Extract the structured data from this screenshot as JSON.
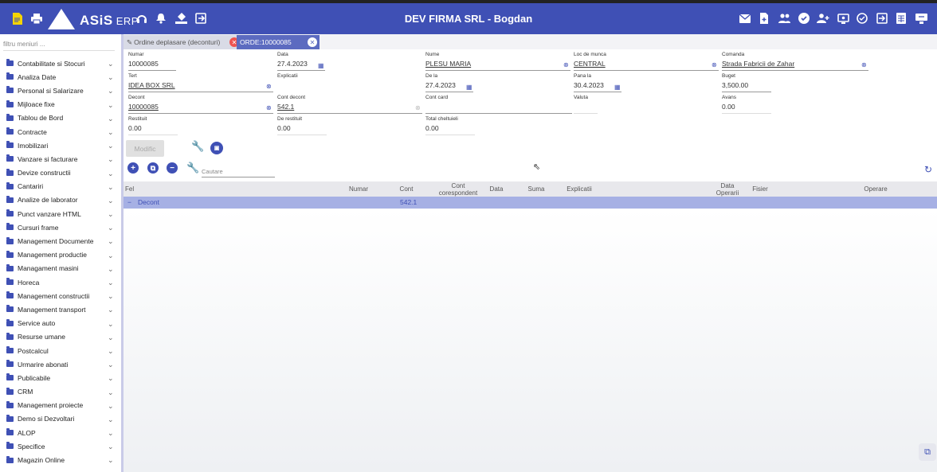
{
  "topbar": {
    "logo_text": "ASiS",
    "logo_suffix": "ERP",
    "title": "DEV FIRMA SRL - Bogdan",
    "left_icons": [
      "document-icon",
      "printer-icon",
      "headset-icon",
      "bell-icon",
      "paint-bucket-icon",
      "exit-icon"
    ],
    "right_icons": [
      "mail-icon",
      "new-file-icon",
      "users-icon",
      "check-circle-icon",
      "user-add-icon",
      "screen-icon",
      "refresh-circle-icon",
      "logout-icon",
      "calculator-icon",
      "desktop-icon"
    ]
  },
  "sidebar": {
    "filter_placeholder": "filtru meniuri ...",
    "items": [
      "Contabilitate si Stocuri",
      "Analiza Date",
      "Personal si Salarizare",
      "Mijloace fixe",
      "Tablou de Bord",
      "Contracte",
      "Imobilizari",
      "Vanzare si facturare",
      "Devize constructii",
      "Cantariri",
      "Analize de laborator",
      "Punct vanzare HTML",
      "Cursuri frame",
      "Management Documente",
      "Management productie",
      "Managament masini",
      "Horeca",
      "Management constructii",
      "Management transport",
      "Service auto",
      "Resurse umane",
      "Postcalcul",
      "Urmarire abonati",
      "Publicabile",
      "CRM",
      "Management proiecte",
      "Demo si Dezvoltari",
      "ALOP",
      "Specifice",
      "Magazin Online"
    ]
  },
  "tabs": [
    {
      "label": "Ordine deplasare (deconturi)"
    },
    {
      "label": "ORDE:10000085"
    }
  ],
  "form": {
    "numar": {
      "label": "Numar",
      "value": "10000085"
    },
    "data": {
      "label": "Data",
      "value": "27.4.2023"
    },
    "nume": {
      "label": "Nume",
      "value": "PLESU MARIA"
    },
    "loc_munca": {
      "label": "Loc de munca",
      "value": "CENTRAL"
    },
    "comanda": {
      "label": "Comanda",
      "value": "Strada Fabricii de Zahar"
    },
    "tert": {
      "label": "Tert",
      "value": "IDEA BOX SRL"
    },
    "explicatii": {
      "label": "Explicatii",
      "value": ""
    },
    "de_la": {
      "label": "De la",
      "value": "27.4.2023"
    },
    "pana_la": {
      "label": "Pana la",
      "value": "30.4.2023"
    },
    "buget": {
      "label": "Buget",
      "value": "3,500.00"
    },
    "decont": {
      "label": "Decont",
      "value": "10000085"
    },
    "cont_decont": {
      "label": "Cont decont",
      "value": "542.1"
    },
    "cont_card": {
      "label": "Cont card",
      "value": ""
    },
    "valuta": {
      "label": "Valuta",
      "value": ""
    },
    "avans": {
      "label": "Avans",
      "value": "0.00"
    },
    "restituit": {
      "label": "Restituit",
      "value": "0.00"
    },
    "de_restituit": {
      "label": "De restituit",
      "value": "0.00"
    },
    "total_cheltuieli": {
      "label": "Total cheltuieli",
      "value": "0.00"
    }
  },
  "buttons": {
    "modifica": "Modific"
  },
  "toolbar": {
    "search_placeholder": "Cautare"
  },
  "table": {
    "columns": [
      "Fel",
      "Numar",
      "Cont",
      "Cont corespondent",
      "Data",
      "Suma",
      "Explicatii",
      "Data Operarii",
      "Fisier",
      "Operare"
    ],
    "rows": [
      {
        "fel": "Decont",
        "cont": "542.1"
      }
    ]
  }
}
